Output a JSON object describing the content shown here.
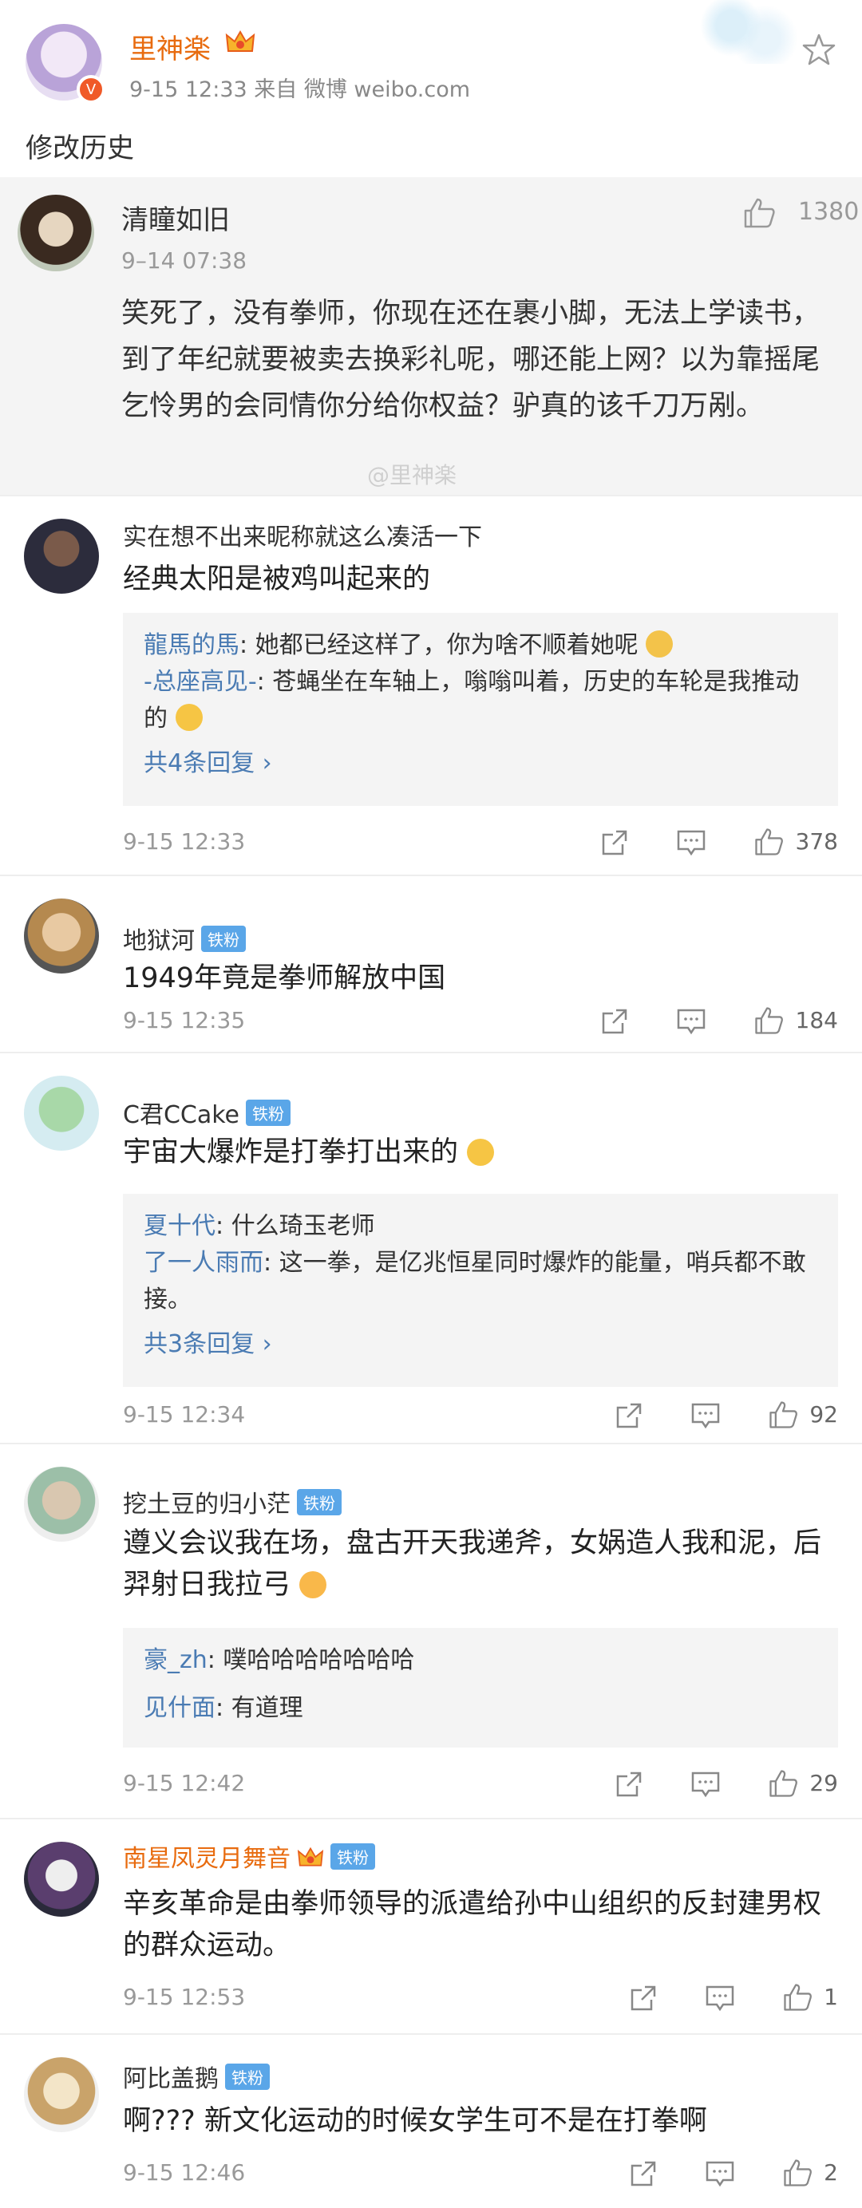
{
  "post": {
    "author": "里神楽",
    "meta": "9-15 12:33   来自 微博 weibo.com",
    "edit_history_label": "修改历史"
  },
  "featured": {
    "name": "清瞳如旧",
    "time": "9–14 07:38",
    "likes": "1380",
    "text": "笑死了，没有拳师，你现在还在裹小脚，无法上学读书，到了年纪就要被卖去换彩礼呢，哪还能上网？以为靠摇尾乞怜男的会同情你分给你权益？驴真的该千刀万剐。",
    "watermark": "@里神楽"
  },
  "comments": [
    {
      "name": "实在想不出来昵称就这么凑活一下",
      "badge": "",
      "text": "经典太阳是被鸡叫起来的",
      "replies": [
        {
          "name": "龍馬的馬",
          "text": ": 她都已经这样了，你为啥不顺着她呢"
        },
        {
          "name": "-总座高见-",
          "text": ": 苍蝇坐在车轴上，嗡嗡叫着，历史的车轮是我推动的"
        }
      ],
      "more": "共4条回复 ›",
      "time": "9-15 12:33",
      "likes": "378"
    },
    {
      "name": "地狱河",
      "badge": "铁粉",
      "text": "1949年竟是拳师解放中国",
      "replies": [],
      "more": "",
      "time": "9-15 12:35",
      "likes": "184"
    },
    {
      "name": "C君CCake",
      "badge": "铁粉",
      "text": "宇宙大爆炸是打拳打出来的",
      "replies": [
        {
          "name": "夏十代",
          "text": ": 什么琦玉老师"
        },
        {
          "name": "了一人雨而",
          "text": ": 这一拳，是亿兆恒星同时爆炸的能量，哨兵都不敢接。"
        }
      ],
      "more": "共3条回复 ›",
      "time": "9-15 12:34",
      "likes": "92"
    },
    {
      "name": "挖土豆的归小茫",
      "badge": "铁粉",
      "text": "遵义会议我在场，盘古开天我递斧，女娲造人我和泥，后羿射日我拉弓",
      "replies": [
        {
          "name": "豪_zh",
          "text": ": 噗哈哈哈哈哈哈哈"
        },
        {
          "name": "见什面",
          "text": ": 有道理"
        }
      ],
      "more": "",
      "time": "9-15 12:42",
      "likes": "29"
    },
    {
      "name": "南星凤灵月舞音",
      "badge": "铁粉",
      "text": "辛亥革命是由拳师领导的派遣给孙中山组织的反封建男权的群众运动。",
      "replies": [],
      "more": "",
      "time": "9-15 12:53",
      "likes": "1"
    },
    {
      "name": "阿比盖鹅",
      "badge": "铁粉",
      "text": "啊??? 新文化运动的时候女学生可不是在打拳啊",
      "replies": [],
      "more": "",
      "time": "9-15 12:46",
      "likes": "2"
    }
  ],
  "colors": {
    "accent_orange": "#e86b0f",
    "link_blue": "#4a7bb3",
    "badge_blue": "#5aa6e8"
  }
}
